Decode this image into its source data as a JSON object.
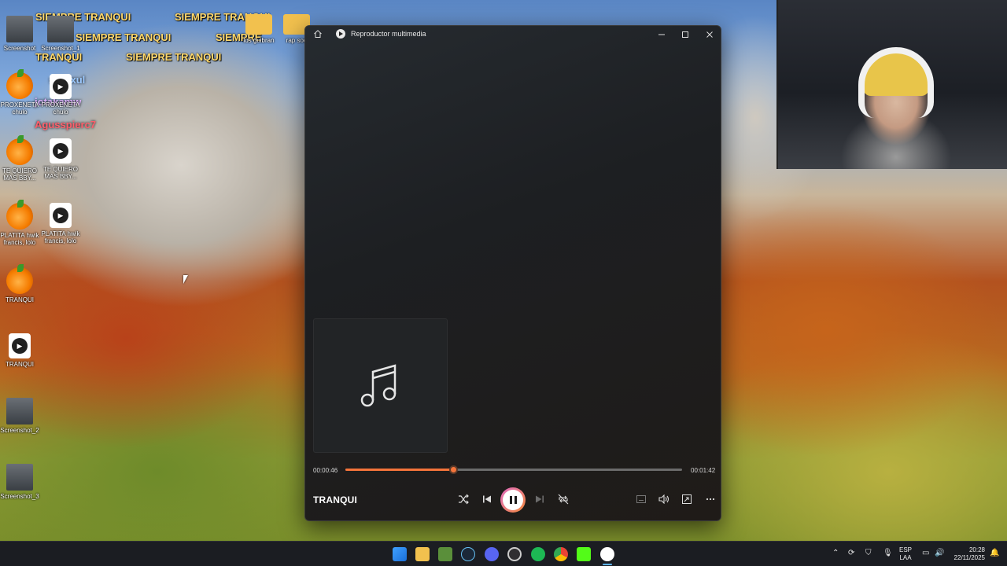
{
  "desktop": {
    "overlay_text": [
      "SIEMPRE TRANQUI",
      "SIEMPRE TRANQUI",
      "SIEMPRE TRANQUI",
      "SIEMPRE",
      "TRANQUI",
      "SIEMPRE TRANQUI"
    ],
    "stream_names": [
      "siHaxul",
      "jotakamw",
      "Agusspierc7"
    ],
    "icons": [
      {
        "label": "Screenshot",
        "icon": "screenshot-icon"
      },
      {
        "label": "Screenshot_1",
        "icon": "screenshot-icon"
      },
      {
        "label": "los guibran",
        "icon": "folder-icon"
      },
      {
        "label": "rap soo",
        "icon": "folder-icon"
      },
      {
        "label": "PROXENETA chulo",
        "icon": "fl-studio-icon"
      },
      {
        "label": "PROXENETA chulo",
        "icon": "media-file-icon"
      },
      {
        "label": "TE QUIERO MAS BBY...",
        "icon": "fl-studio-icon"
      },
      {
        "label": "TE QUIERO MAS BBY...",
        "icon": "media-file-icon"
      },
      {
        "label": "PLATITA hwik francis, lolo",
        "icon": "fl-studio-icon"
      },
      {
        "label": "PLATITA hwik francis, lolo",
        "icon": "media-file-icon"
      },
      {
        "label": "TRANQUI",
        "icon": "fl-studio-icon"
      },
      {
        "label": "TRANQUI",
        "icon": "media-file-icon"
      },
      {
        "label": "Screenshot_2",
        "icon": "screenshot-icon"
      },
      {
        "label": "Screenshot_3",
        "icon": "screenshot-icon"
      }
    ]
  },
  "player": {
    "title": "Reproductor multimedia",
    "current_time": "00:00:46",
    "total_time": "00:01:42",
    "progress": 0.32,
    "track_title": "TRANQUI",
    "state": "playing",
    "accent": "#f5743a"
  },
  "taskbar": {
    "apps": [
      "start-icon",
      "file-explorer-icon",
      "minecraft-icon",
      "steam-icon",
      "discord-icon",
      "obs-icon",
      "spotify-icon",
      "chrome-icon",
      "kick-icon",
      "media-player-icon"
    ],
    "language": "ESP",
    "keyboard": "LAA",
    "time": "20:28",
    "date": "22/11/2025"
  }
}
